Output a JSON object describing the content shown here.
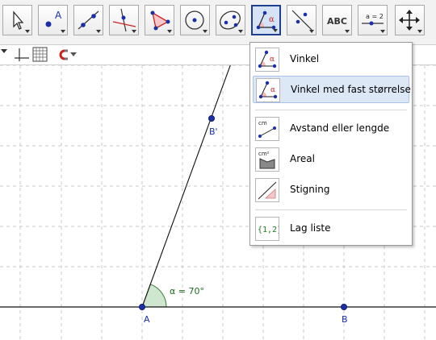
{
  "toolbar": {
    "tools": [
      {
        "name": "move-tool-icon"
      },
      {
        "name": "point-tool-icon",
        "label": "A"
      },
      {
        "name": "line-tool-icon"
      },
      {
        "name": "perpendicular-line-tool-icon"
      },
      {
        "name": "polygon-tool-icon"
      },
      {
        "name": "circle-tool-icon"
      },
      {
        "name": "ellipse-tool-icon"
      },
      {
        "name": "angle-tool-icon",
        "active": true,
        "label": "α"
      },
      {
        "name": "reflect-tool-icon"
      },
      {
        "name": "text-tool-icon",
        "label": "ABC"
      },
      {
        "name": "slider-tool-icon",
        "label": "a = 2"
      },
      {
        "name": "move-graphics-view-icon"
      }
    ]
  },
  "stylebar": {
    "icons": [
      "stylebar-toggle-icon",
      "axes-icon",
      "grid-icon",
      "magnet-icon",
      "dropdown-arrow-icon"
    ]
  },
  "menu": {
    "items": [
      {
        "label": "Vinkel",
        "icon": "angle-icon"
      },
      {
        "label": "Vinkel med fast størrelse",
        "icon": "angle-fixed-size-icon",
        "highlighted": true
      },
      {
        "label": "Avstand eller lengde",
        "icon": "distance-icon",
        "icon_text": "cm"
      },
      {
        "label": "Areal",
        "icon": "area-icon",
        "icon_text": "cm²"
      },
      {
        "label": "Stigning",
        "icon": "slope-icon"
      },
      {
        "label": "Lag liste",
        "icon": "list-icon",
        "icon_text": "{1,2}"
      }
    ]
  },
  "canvas": {
    "points": [
      {
        "label": "A"
      },
      {
        "label": "B"
      },
      {
        "label": "B'"
      }
    ],
    "angle_label": "α = 70°"
  },
  "colors": {
    "point": "#1a2fa8",
    "angle_fill": "#cfe6cf",
    "angle_label": "#1f6b1f",
    "grid": "#c8c8c8",
    "active_tool_border": "#1f3f8f"
  }
}
